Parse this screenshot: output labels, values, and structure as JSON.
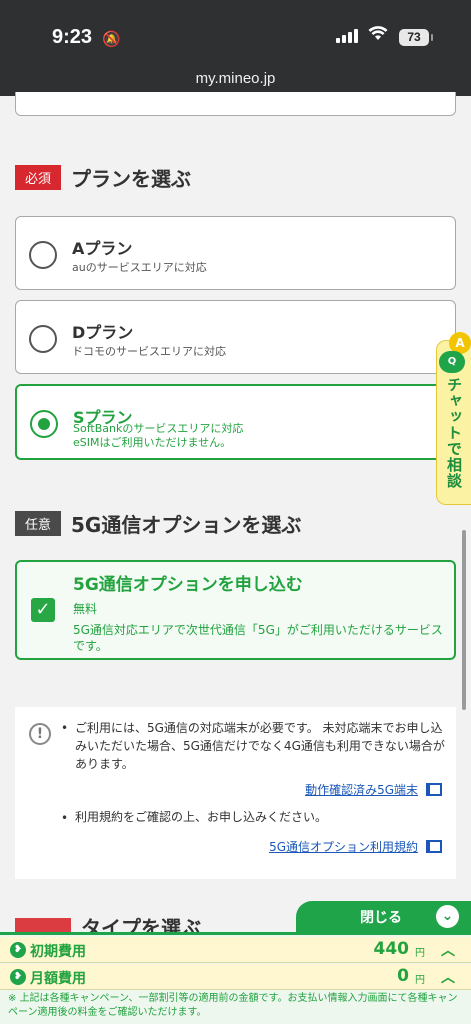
{
  "status_bar": {
    "time": "9:23",
    "battery": "73"
  },
  "url": "my.mineo.jp",
  "plan_section": {
    "tag": "必須",
    "title": "プランを選ぶ",
    "plans": [
      {
        "name": "Aプラン",
        "desc": "auのサービスエリアに対応",
        "note": "",
        "selected": false
      },
      {
        "name": "Dプラン",
        "desc": "ドコモのサービスエリアに対応",
        "note": "",
        "selected": false
      },
      {
        "name": "Sプラン",
        "desc": "SoftBankのサービスエリアに対応",
        "note": "eSIMはご利用いただけません。",
        "selected": true
      }
    ]
  },
  "option_section": {
    "tag": "任意",
    "title": "5G通信オプションを選ぶ",
    "option": {
      "title": "5G通信オプションを申し込む",
      "fee": "無料",
      "desc": "5G通信対応エリアで次世代通信「5G」がご利用いただけるサービスです。",
      "checked": true
    }
  },
  "notice": {
    "items": [
      {
        "text": "ご利用には、5G通信の対応端末が必要です。 未対応端末でお申し込みいただいた場合、5G通信だけでなく4G通信も利用できない場合があります。",
        "link": "動作確認済み5G端末"
      },
      {
        "text": "利用規約をご確認の上、お申し込みください。",
        "link": "5G通信オプション利用規約"
      }
    ]
  },
  "next_section": {
    "title": "タイプを選ぶ"
  },
  "chat": {
    "badge": "A",
    "bubble": "Q",
    "label": "チャットで相談"
  },
  "bottom_panel": {
    "close_label": "閉じる",
    "initial_fee": {
      "label": "初期費用",
      "value": "440",
      "unit": "円"
    },
    "monthly_fee": {
      "label": "月額費用",
      "value": "0",
      "unit": "円"
    },
    "footnote": "※ 上記は各種キャンペーン、一部割引等の適用前の金額です。お支払い情報入力画面にて各種キャンペーン適用後の料金をご確認いただけます。"
  },
  "colors": {
    "brand_green": "#1fa44a",
    "required_red": "#d7282f",
    "link_blue": "#1a57b8"
  }
}
